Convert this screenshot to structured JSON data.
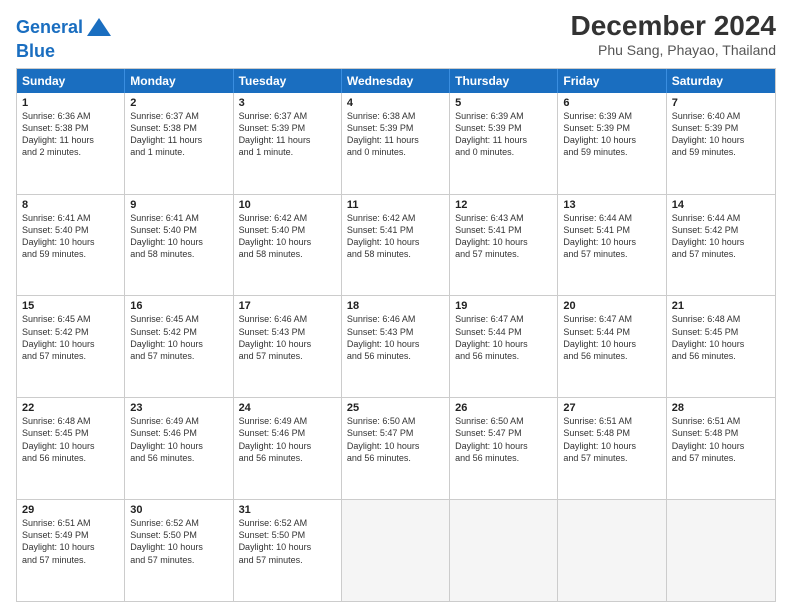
{
  "logo": {
    "line1": "General",
    "line2": "Blue"
  },
  "title": "December 2024",
  "subtitle": "Phu Sang, Phayao, Thailand",
  "weekdays": [
    "Sunday",
    "Monday",
    "Tuesday",
    "Wednesday",
    "Thursday",
    "Friday",
    "Saturday"
  ],
  "rows": [
    [
      {
        "day": "1",
        "info": "Sunrise: 6:36 AM\nSunset: 5:38 PM\nDaylight: 11 hours\nand 2 minutes."
      },
      {
        "day": "2",
        "info": "Sunrise: 6:37 AM\nSunset: 5:38 PM\nDaylight: 11 hours\nand 1 minute."
      },
      {
        "day": "3",
        "info": "Sunrise: 6:37 AM\nSunset: 5:39 PM\nDaylight: 11 hours\nand 1 minute."
      },
      {
        "day": "4",
        "info": "Sunrise: 6:38 AM\nSunset: 5:39 PM\nDaylight: 11 hours\nand 0 minutes."
      },
      {
        "day": "5",
        "info": "Sunrise: 6:39 AM\nSunset: 5:39 PM\nDaylight: 11 hours\nand 0 minutes."
      },
      {
        "day": "6",
        "info": "Sunrise: 6:39 AM\nSunset: 5:39 PM\nDaylight: 10 hours\nand 59 minutes."
      },
      {
        "day": "7",
        "info": "Sunrise: 6:40 AM\nSunset: 5:39 PM\nDaylight: 10 hours\nand 59 minutes."
      }
    ],
    [
      {
        "day": "8",
        "info": "Sunrise: 6:41 AM\nSunset: 5:40 PM\nDaylight: 10 hours\nand 59 minutes."
      },
      {
        "day": "9",
        "info": "Sunrise: 6:41 AM\nSunset: 5:40 PM\nDaylight: 10 hours\nand 58 minutes."
      },
      {
        "day": "10",
        "info": "Sunrise: 6:42 AM\nSunset: 5:40 PM\nDaylight: 10 hours\nand 58 minutes."
      },
      {
        "day": "11",
        "info": "Sunrise: 6:42 AM\nSunset: 5:41 PM\nDaylight: 10 hours\nand 58 minutes."
      },
      {
        "day": "12",
        "info": "Sunrise: 6:43 AM\nSunset: 5:41 PM\nDaylight: 10 hours\nand 57 minutes."
      },
      {
        "day": "13",
        "info": "Sunrise: 6:44 AM\nSunset: 5:41 PM\nDaylight: 10 hours\nand 57 minutes."
      },
      {
        "day": "14",
        "info": "Sunrise: 6:44 AM\nSunset: 5:42 PM\nDaylight: 10 hours\nand 57 minutes."
      }
    ],
    [
      {
        "day": "15",
        "info": "Sunrise: 6:45 AM\nSunset: 5:42 PM\nDaylight: 10 hours\nand 57 minutes."
      },
      {
        "day": "16",
        "info": "Sunrise: 6:45 AM\nSunset: 5:42 PM\nDaylight: 10 hours\nand 57 minutes."
      },
      {
        "day": "17",
        "info": "Sunrise: 6:46 AM\nSunset: 5:43 PM\nDaylight: 10 hours\nand 57 minutes."
      },
      {
        "day": "18",
        "info": "Sunrise: 6:46 AM\nSunset: 5:43 PM\nDaylight: 10 hours\nand 56 minutes."
      },
      {
        "day": "19",
        "info": "Sunrise: 6:47 AM\nSunset: 5:44 PM\nDaylight: 10 hours\nand 56 minutes."
      },
      {
        "day": "20",
        "info": "Sunrise: 6:47 AM\nSunset: 5:44 PM\nDaylight: 10 hours\nand 56 minutes."
      },
      {
        "day": "21",
        "info": "Sunrise: 6:48 AM\nSunset: 5:45 PM\nDaylight: 10 hours\nand 56 minutes."
      }
    ],
    [
      {
        "day": "22",
        "info": "Sunrise: 6:48 AM\nSunset: 5:45 PM\nDaylight: 10 hours\nand 56 minutes."
      },
      {
        "day": "23",
        "info": "Sunrise: 6:49 AM\nSunset: 5:46 PM\nDaylight: 10 hours\nand 56 minutes."
      },
      {
        "day": "24",
        "info": "Sunrise: 6:49 AM\nSunset: 5:46 PM\nDaylight: 10 hours\nand 56 minutes."
      },
      {
        "day": "25",
        "info": "Sunrise: 6:50 AM\nSunset: 5:47 PM\nDaylight: 10 hours\nand 56 minutes."
      },
      {
        "day": "26",
        "info": "Sunrise: 6:50 AM\nSunset: 5:47 PM\nDaylight: 10 hours\nand 56 minutes."
      },
      {
        "day": "27",
        "info": "Sunrise: 6:51 AM\nSunset: 5:48 PM\nDaylight: 10 hours\nand 57 minutes."
      },
      {
        "day": "28",
        "info": "Sunrise: 6:51 AM\nSunset: 5:48 PM\nDaylight: 10 hours\nand 57 minutes."
      }
    ],
    [
      {
        "day": "29",
        "info": "Sunrise: 6:51 AM\nSunset: 5:49 PM\nDaylight: 10 hours\nand 57 minutes."
      },
      {
        "day": "30",
        "info": "Sunrise: 6:52 AM\nSunset: 5:50 PM\nDaylight: 10 hours\nand 57 minutes."
      },
      {
        "day": "31",
        "info": "Sunrise: 6:52 AM\nSunset: 5:50 PM\nDaylight: 10 hours\nand 57 minutes."
      },
      {
        "day": "",
        "info": ""
      },
      {
        "day": "",
        "info": ""
      },
      {
        "day": "",
        "info": ""
      },
      {
        "day": "",
        "info": ""
      }
    ]
  ]
}
